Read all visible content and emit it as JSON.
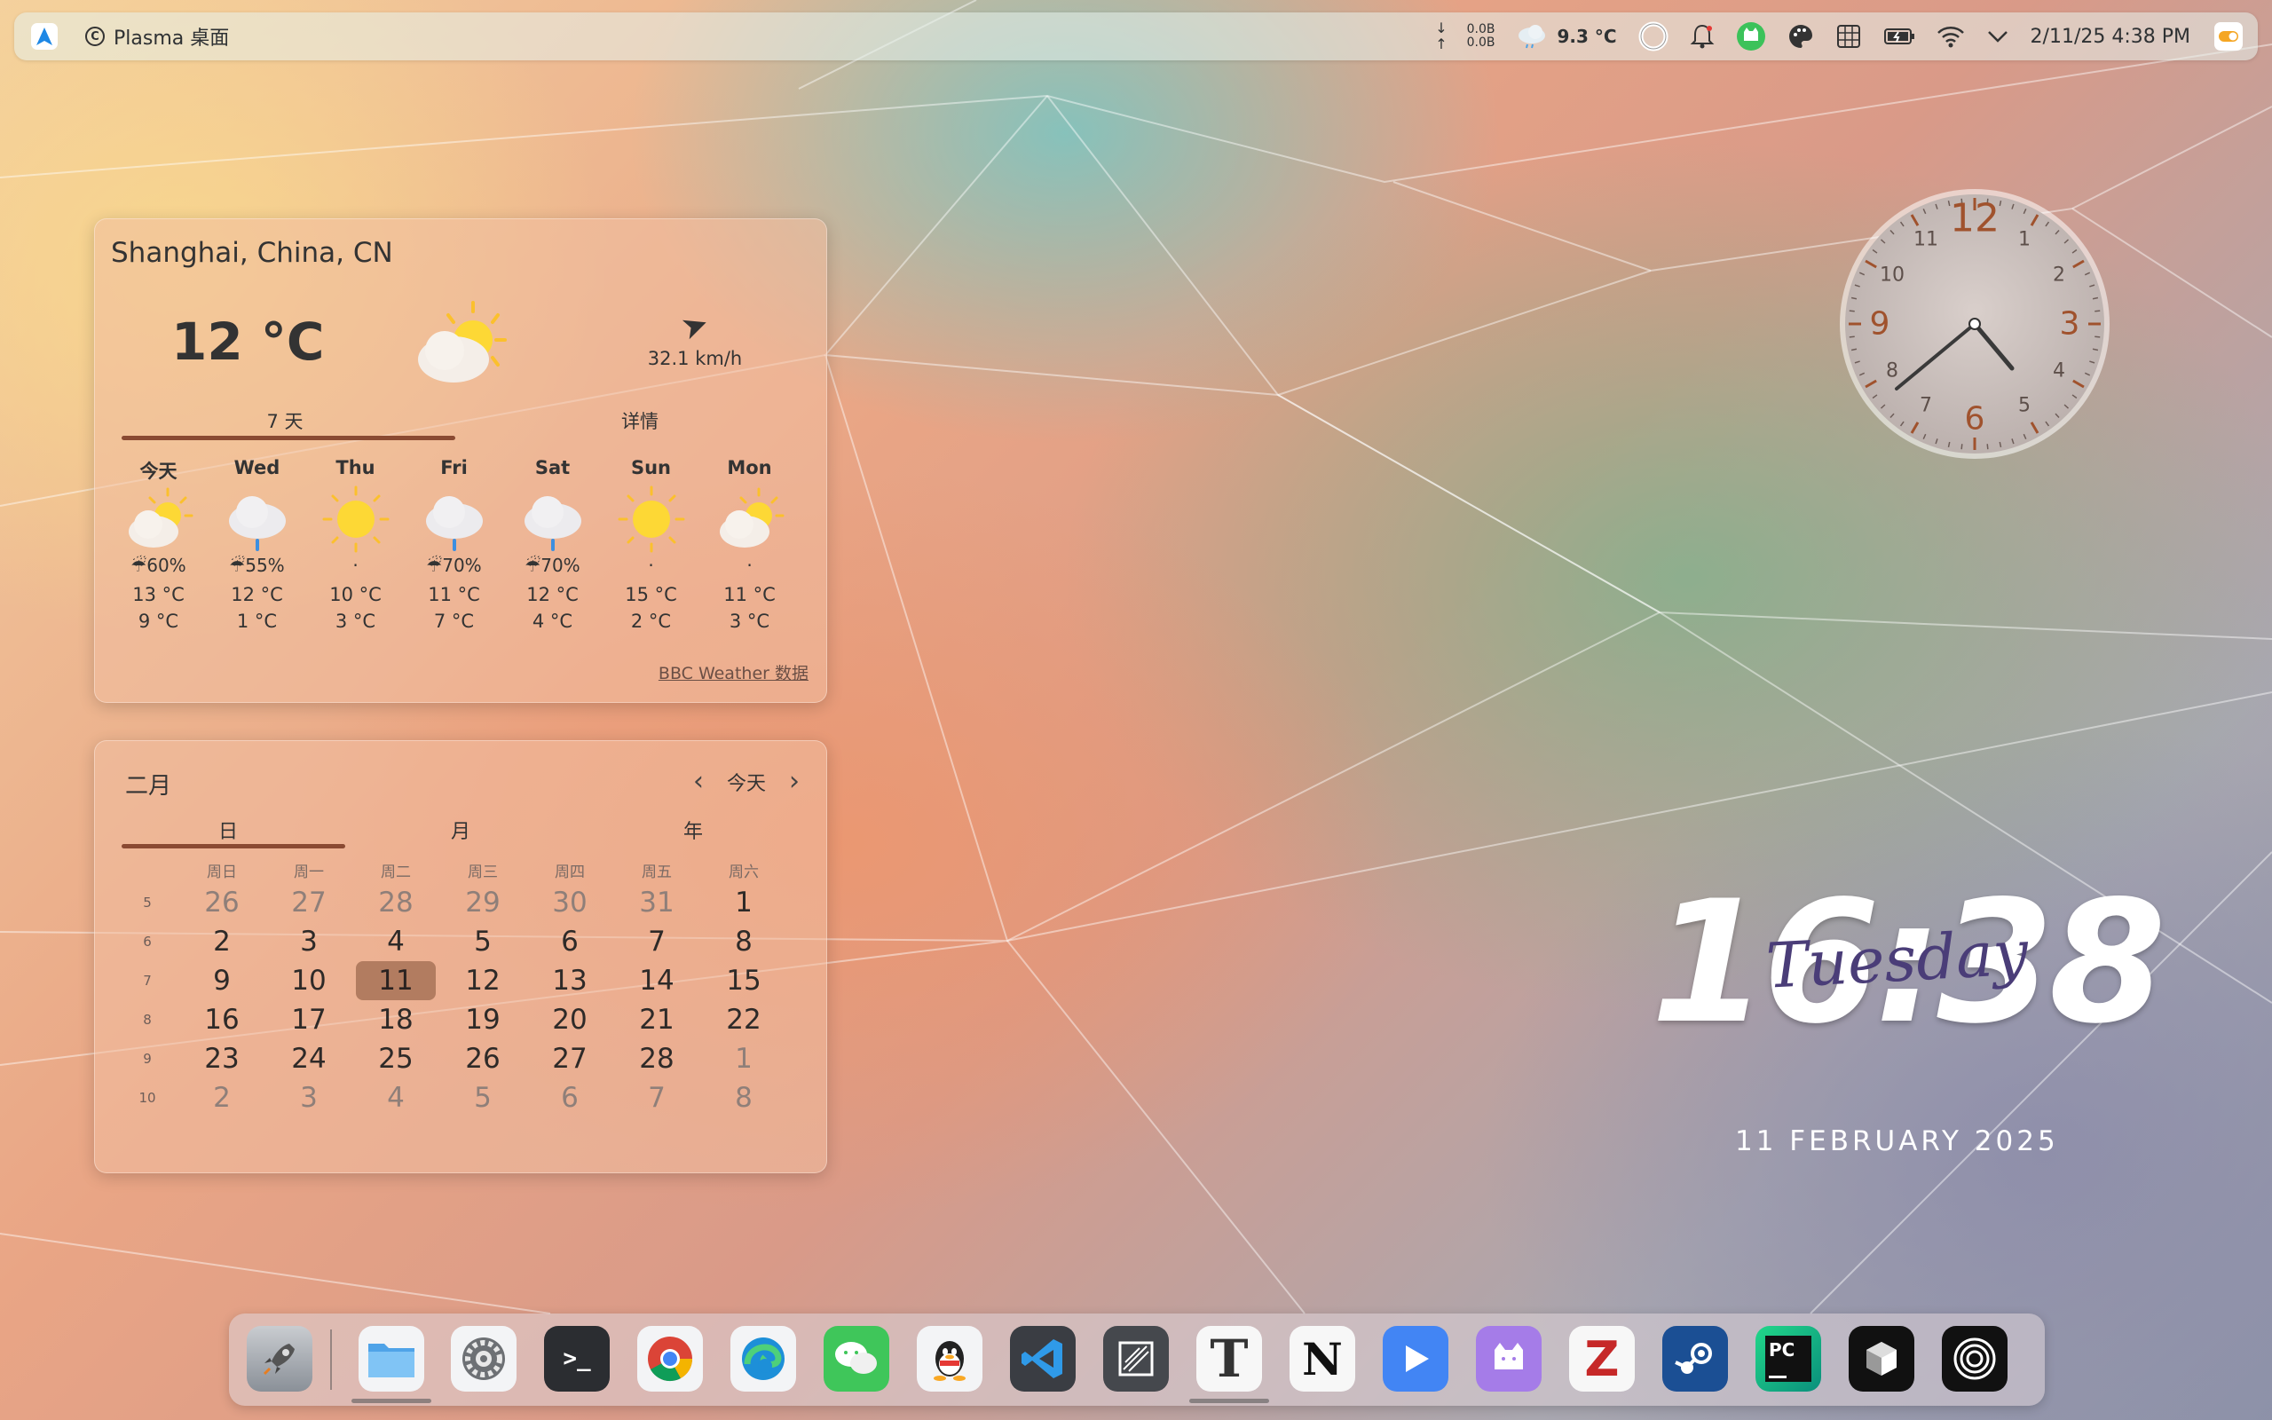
{
  "topbar": {
    "app_name": "Plasma 桌面",
    "net_down": "0.0B",
    "net_up": "0.0B",
    "weather_temp": "9.3 °C",
    "datetime": "2/11/25 4:38 PM"
  },
  "weather": {
    "location": "Shanghai, China, CN",
    "temperature": "12 °C",
    "wind_speed": "32.1 km/h",
    "tabs": [
      "7 天",
      "详情"
    ],
    "days": [
      {
        "name": "今天",
        "icon": "partly-cloudy-icon",
        "rain": "☔60%",
        "high": "13 °C",
        "low": "9 °C"
      },
      {
        "name": "Wed",
        "icon": "rain-cloud-icon",
        "rain": "☔55%",
        "high": "12 °C",
        "low": "1 °C"
      },
      {
        "name": "Thu",
        "icon": "sun-icon",
        "rain": "·",
        "high": "10 °C",
        "low": "3 °C"
      },
      {
        "name": "Fri",
        "icon": "rain-cloud-icon",
        "rain": "☔70%",
        "high": "11 °C",
        "low": "7 °C"
      },
      {
        "name": "Sat",
        "icon": "rain-cloud-icon",
        "rain": "☔70%",
        "high": "12 °C",
        "low": "4 °C"
      },
      {
        "name": "Sun",
        "icon": "sun-icon",
        "rain": "·",
        "high": "15 °C",
        "low": "2 °C"
      },
      {
        "name": "Mon",
        "icon": "partly-cloudy-icon",
        "rain": "·",
        "high": "11 °C",
        "low": "3 °C"
      }
    ],
    "credit": "BBC Weather 数据"
  },
  "calendar": {
    "month": "二月",
    "today_button": "今天",
    "tabs": [
      "日",
      "月",
      "年"
    ],
    "weekday_headers": [
      "周日",
      "周一",
      "周二",
      "周三",
      "周四",
      "周五",
      "周六"
    ],
    "weeks": [
      {
        "num": "5",
        "days": [
          "26",
          "27",
          "28",
          "29",
          "30",
          "31",
          "1"
        ]
      },
      {
        "num": "6",
        "days": [
          "2",
          "3",
          "4",
          "5",
          "6",
          "7",
          "8"
        ]
      },
      {
        "num": "7",
        "days": [
          "9",
          "10",
          "11",
          "12",
          "13",
          "14",
          "15"
        ]
      },
      {
        "num": "8",
        "days": [
          "16",
          "17",
          "18",
          "19",
          "20",
          "21",
          "22"
        ]
      },
      {
        "num": "9",
        "days": [
          "23",
          "24",
          "25",
          "26",
          "27",
          "28",
          "1"
        ]
      },
      {
        "num": "10",
        "days": [
          "2",
          "3",
          "4",
          "5",
          "6",
          "7",
          "8"
        ]
      }
    ],
    "selected_day": "11"
  },
  "clock": {
    "numerals": [
      "12",
      "1",
      "2",
      "3",
      "4",
      "5",
      "6",
      "7",
      "8",
      "9",
      "10",
      "11"
    ]
  },
  "desktop_clock": {
    "time": "16:38",
    "day": "Tuesday",
    "date": "11 FEBRUARY 2025"
  },
  "dock": {
    "apps": [
      "launcher-icon",
      "files-icon",
      "settings-icon",
      "terminal-icon",
      "chrome-icon",
      "edge-icon",
      "wechat-icon",
      "qq-icon",
      "vscode-icon",
      "typora-icon",
      "text-editor-icon",
      "notion-icon",
      "video-player-icon",
      "cat-app-icon",
      "zotero-icon",
      "steam-icon",
      "pycharm-icon",
      "cube-app-icon",
      "spiral-app-icon"
    ]
  },
  "colors": {
    "accent": "#8a4a32",
    "selected_day_bg": "#b27c60",
    "clock_accent": "#a0522d"
  }
}
